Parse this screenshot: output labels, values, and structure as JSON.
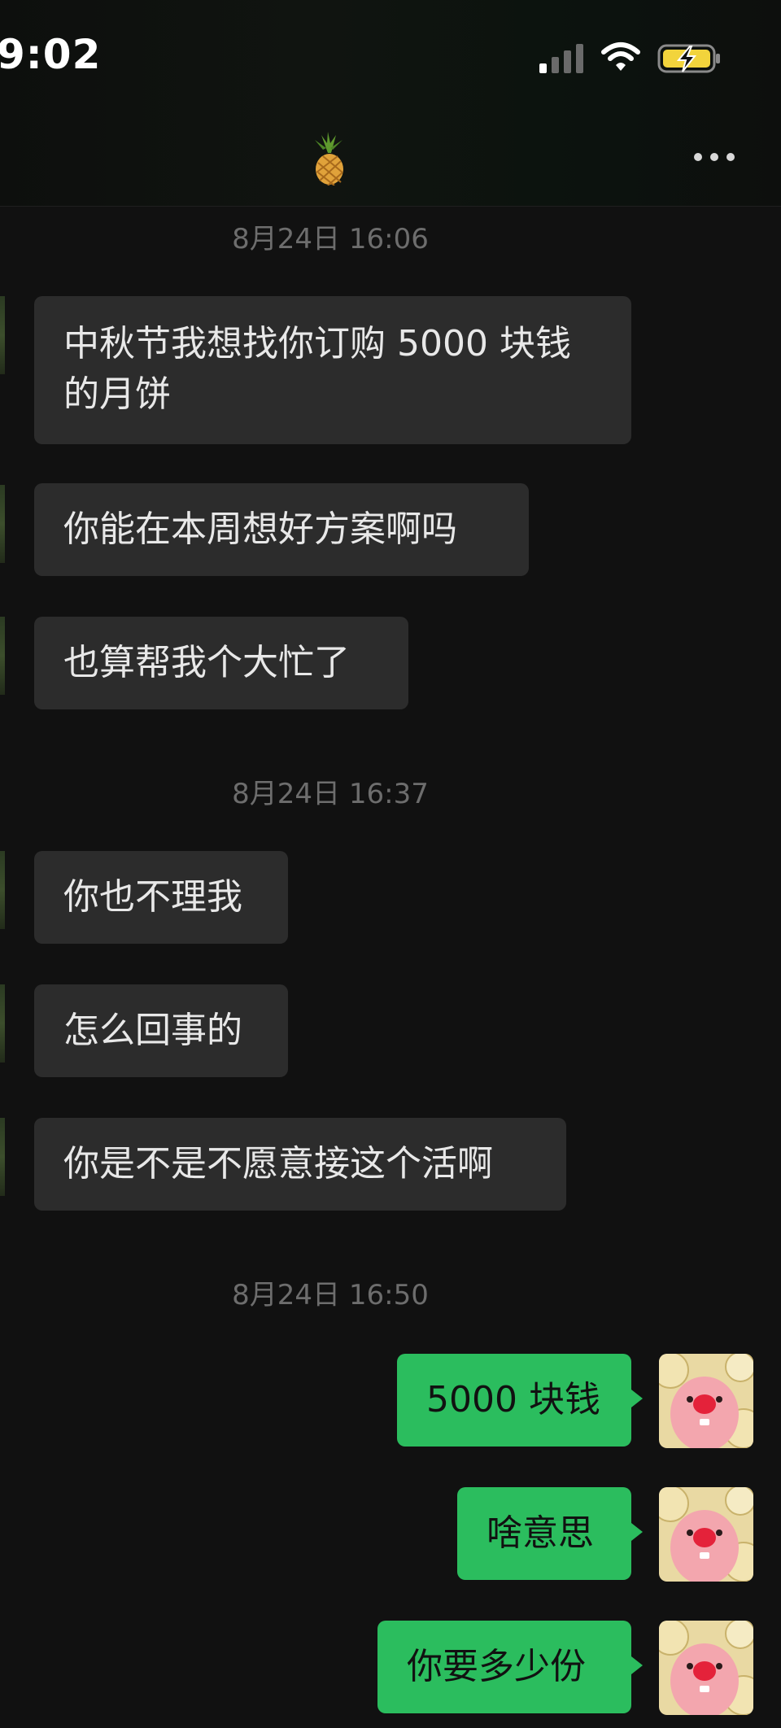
{
  "status_bar": {
    "time": "9:02"
  },
  "header": {
    "contact_icon": "pineapple-emoji",
    "more_icon": "more-icon"
  },
  "colors": {
    "background": "#111111",
    "incoming_bubble": "#2c2c2c",
    "outgoing_bubble": "#2bbd5e",
    "timestamp_text": "#6d6d6d",
    "battery_fill": "#f2d43c"
  },
  "chat": {
    "timestamps": [
      "8月24日 16:06",
      "8月24日 16:37",
      "8月24日 16:50"
    ],
    "messages": [
      {
        "direction": "in",
        "lines": [
          "中秋节我想找你订购 5000 块钱",
          "的月饼"
        ]
      },
      {
        "direction": "in",
        "lines": [
          "你能在本周想好方案啊吗"
        ]
      },
      {
        "direction": "in",
        "lines": [
          "也算帮我个大忙了"
        ]
      },
      {
        "direction": "in",
        "lines": [
          "你也不理我"
        ]
      },
      {
        "direction": "in",
        "lines": [
          "怎么回事的"
        ]
      },
      {
        "direction": "in",
        "lines": [
          "你是不是不愿意接这个活啊"
        ]
      },
      {
        "direction": "out",
        "lines": [
          "5000 块钱"
        ]
      },
      {
        "direction": "out",
        "lines": [
          "啥意思"
        ]
      },
      {
        "direction": "out",
        "lines": [
          "你要多少份"
        ]
      }
    ]
  }
}
